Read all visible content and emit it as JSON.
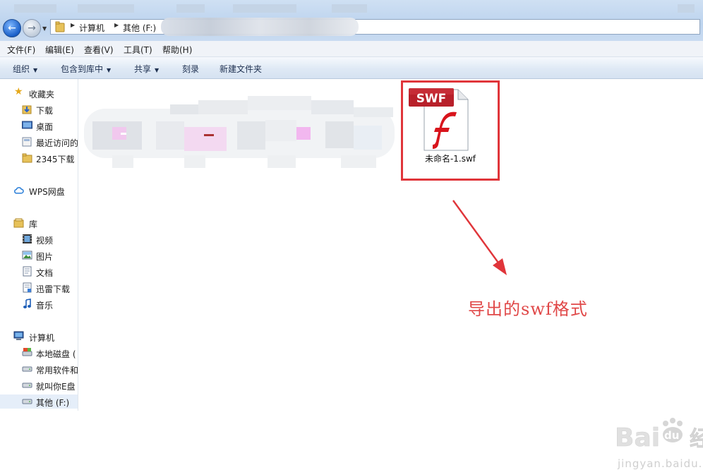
{
  "address_bar": {
    "breadcrumbs": [
      "计算机",
      "其他 (F:)"
    ]
  },
  "menu": [
    "文件(F)",
    "编辑(E)",
    "查看(V)",
    "工具(T)",
    "帮助(H)"
  ],
  "toolbar": {
    "organize": "组织",
    "include_in_library": "包含到库中",
    "share": "共享",
    "burn": "刻录",
    "new_folder": "新建文件夹"
  },
  "nav": {
    "favorites": {
      "title": "收藏夹",
      "items": [
        "下载",
        "桌面",
        "最近访问的",
        "2345下载"
      ]
    },
    "wps": "WPS网盘",
    "libraries": {
      "title": "库",
      "items": [
        "视频",
        "图片",
        "文档",
        "迅雷下载",
        "音乐"
      ]
    },
    "computer": {
      "title": "计算机",
      "items": [
        "本地磁盘 (",
        "常用软件和",
        "就叫你E盘",
        "其他 (F:)"
      ]
    }
  },
  "file": {
    "badge": "SWF",
    "name": "未命名-1.swf"
  },
  "annotation": "导出的swf格式",
  "watermark": {
    "brand": "Bai",
    "brand2": "du",
    "cn": "经验",
    "url": "jingyan.baidu.com"
  },
  "colors": {
    "highlight": "#e0353a",
    "annotation": "#e04848",
    "swf_badge": "#b8202a",
    "flash_f": "#d8141c"
  },
  "icons": {
    "back": "back-arrow-icon",
    "forward": "forward-arrow-icon",
    "folder": "folder-icon",
    "star": "star-icon",
    "cloud": "cloud-icon",
    "drive": "drive-icon"
  }
}
